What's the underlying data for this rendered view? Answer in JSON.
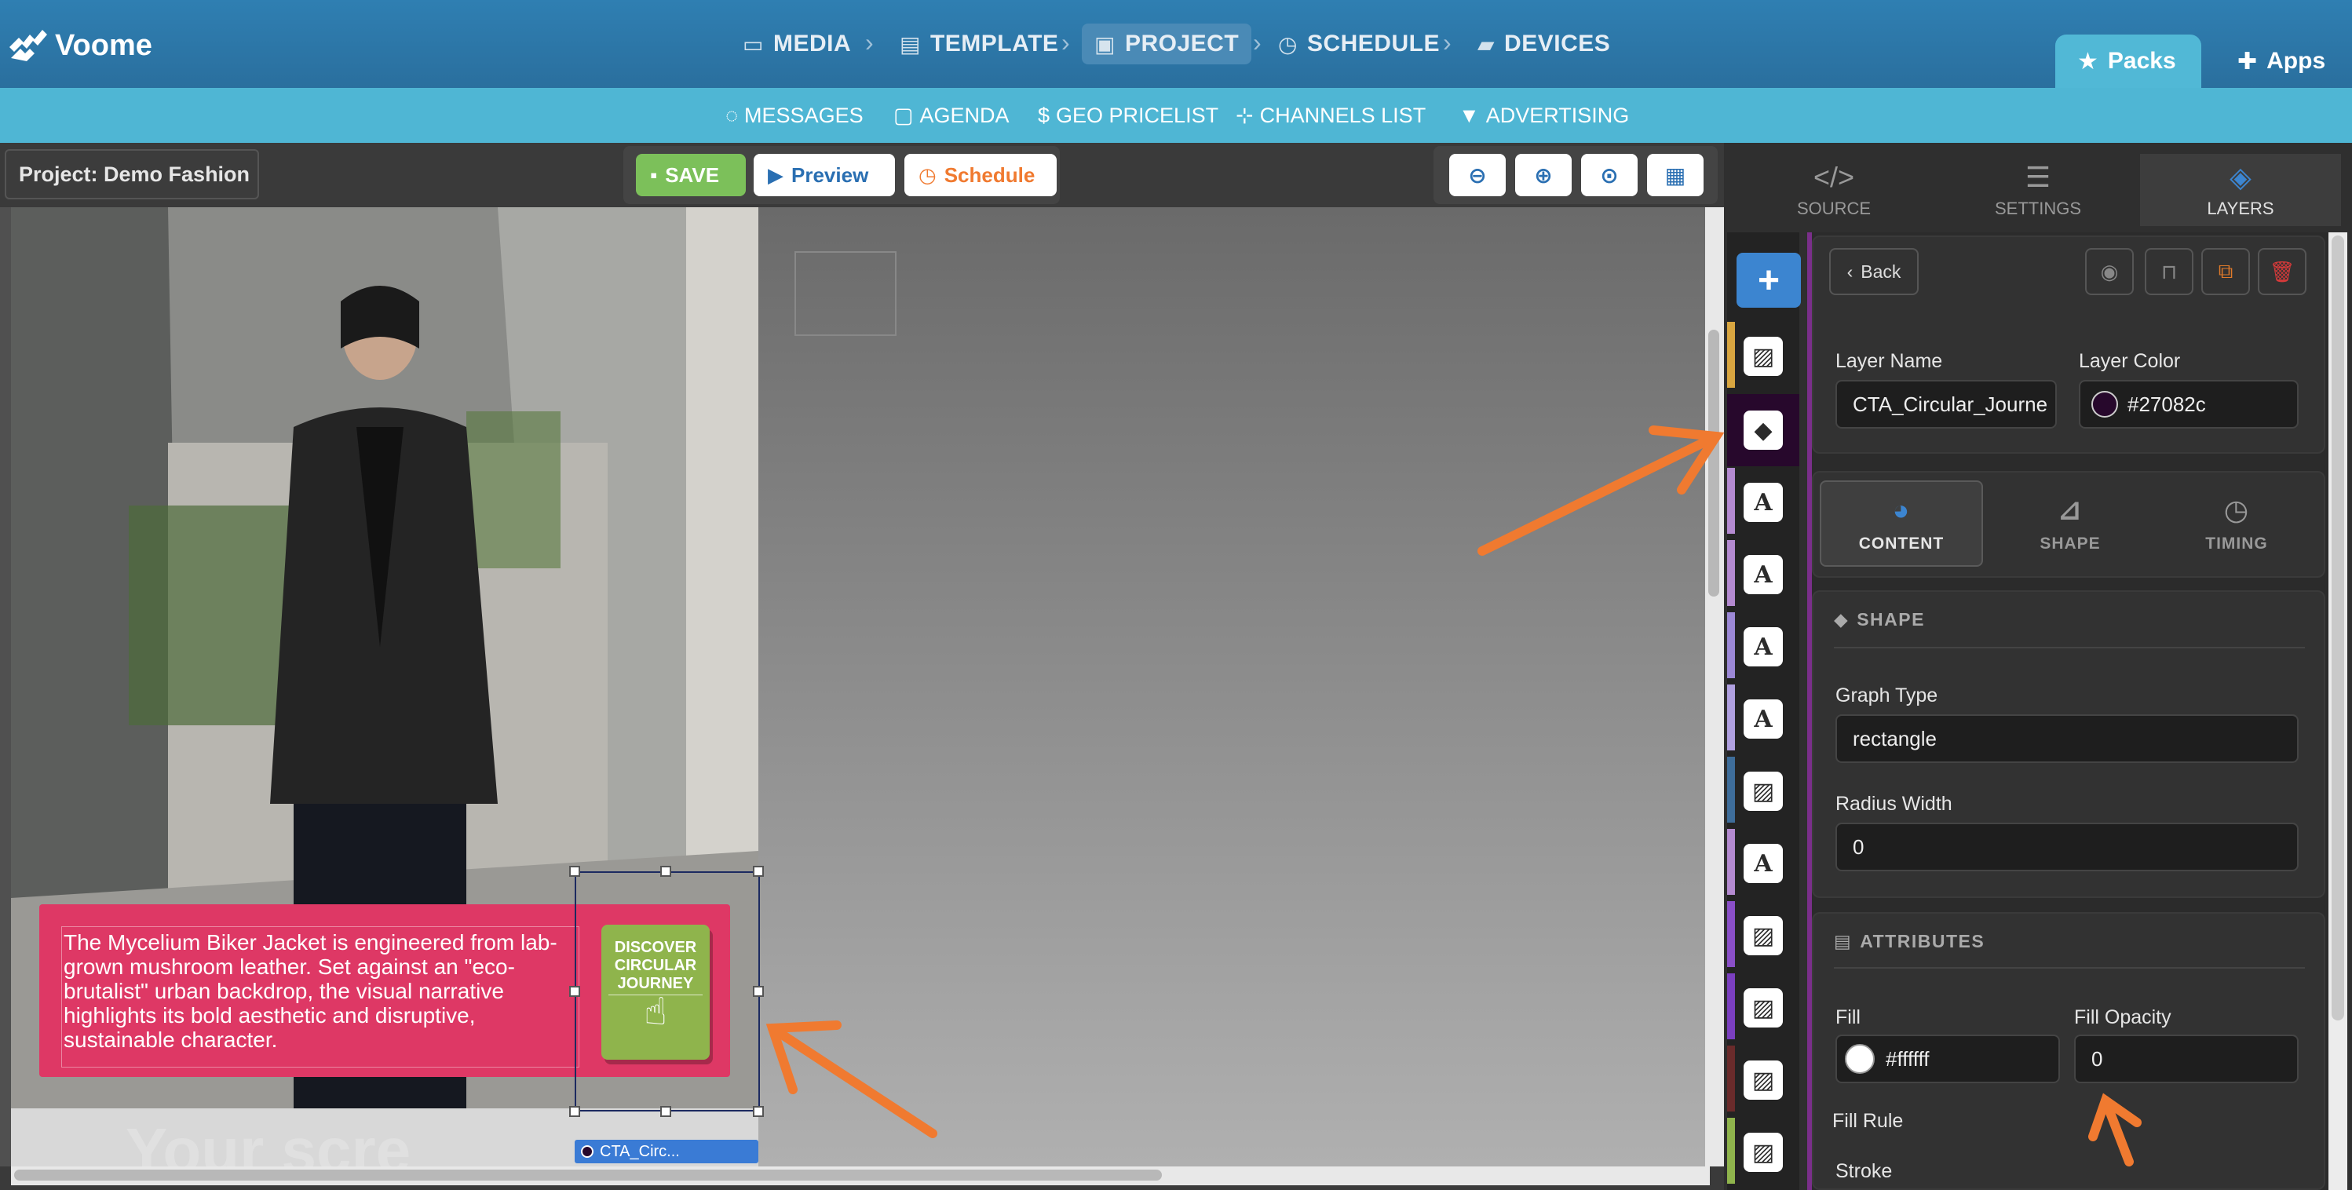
{
  "app": {
    "name": "Voome"
  },
  "nav": {
    "main": [
      {
        "label": "MEDIA",
        "icon": "image-icon"
      },
      {
        "label": "TEMPLATE",
        "icon": "book-icon"
      },
      {
        "label": "PROJECT",
        "icon": "project-icon",
        "active": true
      },
      {
        "label": "SCHEDULE",
        "icon": "clock-icon"
      },
      {
        "label": "DEVICES",
        "icon": "devices-icon"
      }
    ],
    "packs_label": "Packs",
    "apps_label": "Apps",
    "sub": [
      {
        "label": "MESSAGES",
        "icon": "chat-icon"
      },
      {
        "label": "AGENDA",
        "icon": "calendar-icon"
      },
      {
        "label": "GEO PRICELIST",
        "icon": "dollar-icon"
      },
      {
        "label": "CHANNELS LIST",
        "icon": "sitemap-icon"
      },
      {
        "label": "ADVERTISING",
        "icon": "filter-dollar-icon"
      }
    ]
  },
  "editor": {
    "project_label": "Project: Demo Fashion",
    "save_label": "SAVE",
    "preview_label": "Preview",
    "schedule_label": "Schedule",
    "caption": "The Mycelium Biker Jacket is engineered from lab-grown mushroom leather. Set against an \"eco-brutalist\" urban backdrop, the visual narrative highlights its bold aesthetic and disruptive, sustainable character.",
    "cta_lines": [
      "DISCOVER",
      "CIRCULAR",
      "JOURNEY"
    ],
    "layer_tag": "CTA_Circ...",
    "watermark": "Your scre"
  },
  "panel": {
    "tabs": [
      {
        "label": "SOURCE",
        "icon": "code-icon"
      },
      {
        "label": "SETTINGS",
        "icon": "sliders-icon"
      },
      {
        "label": "LAYERS",
        "icon": "layers-icon",
        "active": true
      }
    ],
    "back_label": "Back",
    "layer_name_label": "Layer Name",
    "layer_name_value": "CTA_Circular_Journe",
    "layer_color_label": "Layer Color",
    "layer_color_value": "#27082c",
    "content_tabs": [
      {
        "label": "CONTENT",
        "icon": "palette-icon",
        "active": true
      },
      {
        "label": "SHAPE",
        "icon": "ruler-icon"
      },
      {
        "label": "TIMING",
        "icon": "clock-icon"
      }
    ],
    "shape_section": "SHAPE",
    "graph_type_label": "Graph Type",
    "graph_type_value": "rectangle",
    "radius_label": "Radius Width",
    "radius_value": "0",
    "attributes_section": "ATTRIBUTES",
    "fill_label": "Fill",
    "fill_value": "#ffffff",
    "fill_opacity_label": "Fill Opacity",
    "fill_opacity_value": "0",
    "fill_rule_label": "Fill Rule",
    "stroke_label": "Stroke"
  },
  "colors": {
    "topbar": "#2f7fb2",
    "subbar": "#4fb6d4",
    "accent_blue": "#3c85d0",
    "caption_bg": "#de3865",
    "cta_green": "#8fb44c",
    "annotation_arrow": "#f07a30",
    "layer_color": "#27082c"
  }
}
